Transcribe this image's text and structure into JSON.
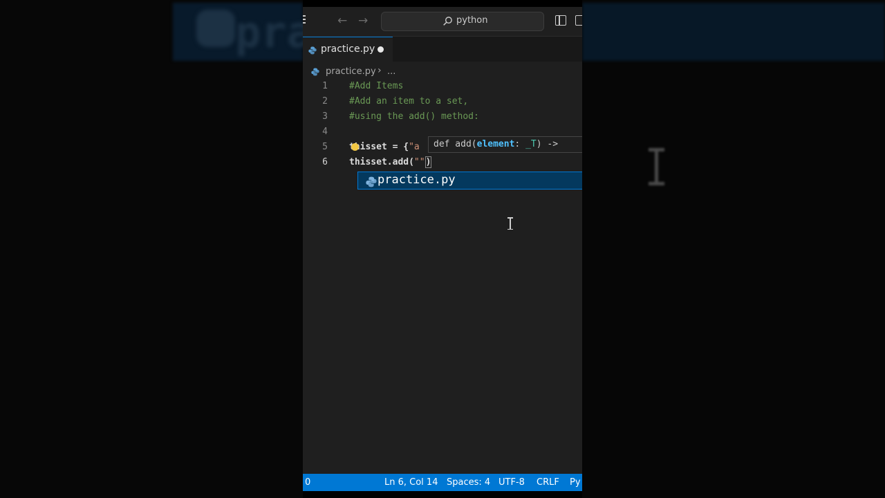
{
  "search": {
    "text": "python"
  },
  "tab": {
    "label": "practice.py"
  },
  "breadcrumb": {
    "file": "practice.py",
    "separator": "›",
    "more": "..."
  },
  "code": {
    "lines": [
      {
        "num": "1",
        "text": "#Add Items"
      },
      {
        "num": "2",
        "text": "#Add an item to a set,"
      },
      {
        "num": "3",
        "text": "#using the add() method:"
      },
      {
        "num": "4",
        "text": ""
      },
      {
        "num": "5",
        "text_prefix": "thisset = {",
        "text_str": "\"a"
      },
      {
        "num": "6",
        "text_prefix": "thisset.add(",
        "text_str": "\"\"",
        "text_suffix": ")"
      }
    ]
  },
  "hover": {
    "prefix": "def add(",
    "param": "element",
    "colon": ": ",
    "type": "_T",
    "suffix": ") ->"
  },
  "suggestion": {
    "label": "practice.py"
  },
  "status": {
    "left": "0",
    "position": "Ln 6, Col 14",
    "spaces": "Spaces: 4",
    "encoding": "UTF-8",
    "eol": "CRLF",
    "language": "Py"
  },
  "colors": {
    "accent": "#0078d4",
    "comment": "#6a9955",
    "string": "#ce9178"
  }
}
